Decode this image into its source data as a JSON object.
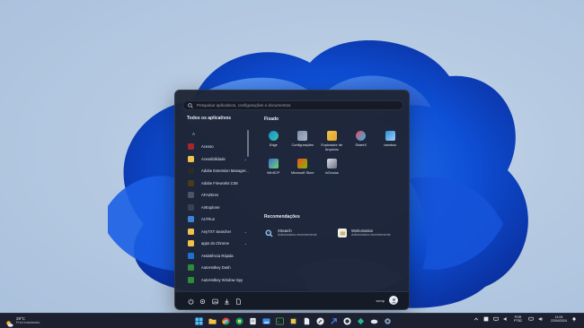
{
  "start_menu": {
    "search_placeholder": "Pesquisar aplicativos, configurações e documentos",
    "all_apps_header": "Todos os aplicativos",
    "section_letter": "A",
    "apps": [
      {
        "label": "Acesso",
        "icon": "access-icon",
        "color": "#a4262c",
        "expandable": false
      },
      {
        "label": "Acessibilidade",
        "icon": "folder-icon",
        "color": "#f2c04b",
        "expandable": true
      },
      {
        "label": "Adobe Extension Manager...",
        "icon": "adobe-extension-icon",
        "color": "#2b2b2b",
        "expandable": false
      },
      {
        "label": "Adobe Fireworks CS6",
        "icon": "fireworks-icon",
        "color": "#4a3a1a",
        "expandable": false
      },
      {
        "label": "AFAZEres",
        "icon": "afazeres-icon",
        "color": "#4b5567",
        "expandable": false
      },
      {
        "label": "AirExplorer",
        "icon": "airexplorer-icon",
        "color": "#3a4252",
        "expandable": false
      },
      {
        "label": "ALTRun",
        "icon": "altrun-icon",
        "color": "#3c82d6",
        "expandable": false
      },
      {
        "label": "AnyTXT Searcher",
        "icon": "folder-icon",
        "color": "#f2c04b",
        "expandable": true
      },
      {
        "label": "apps do Chrome",
        "icon": "folder-icon",
        "color": "#f2c04b",
        "expandable": true
      },
      {
        "label": "Assistência Rápida",
        "icon": "quick-assist-icon",
        "color": "#1f6fd1",
        "expandable": false
      },
      {
        "label": "AutoHotkey Dash",
        "icon": "autohotkey-icon",
        "color": "#2e8b3a",
        "expandable": false
      },
      {
        "label": "AutoHotkey Window Spy",
        "icon": "autohotkey-icon",
        "color": "#2e8b3a",
        "expandable": false
      }
    ],
    "pinned_header": "Fixado",
    "pinned": [
      {
        "label": "Edge",
        "icon": "edge-icon"
      },
      {
        "label": "Configurações",
        "icon": "settings-icon"
      },
      {
        "label": "Explorador de Arquivos",
        "icon": "file-explorer-icon"
      },
      {
        "label": "ShareX",
        "icon": "sharex-icon"
      },
      {
        "label": "bamboo",
        "icon": "bamboo-icon"
      },
      {
        "label": "WinSCP",
        "icon": "winscp-icon"
      },
      {
        "label": "Microsoft Store",
        "icon": "store-icon"
      },
      {
        "label": "InOculus",
        "icon": "inoculus-icon"
      }
    ],
    "recommended_header": "Recomendações",
    "recommended": [
      {
        "title": "XSearch",
        "subtitle": "Adicionados recentemente",
        "icon": "xsearch-icon"
      },
      {
        "title": "Workomation",
        "subtitle": "Adicionados recentemente",
        "icon": "workomation-icon"
      }
    ],
    "user_name": "ssmp",
    "bottom_icons": [
      "power-icon",
      "settings-icon",
      "gallery-icon",
      "downloads-icon",
      "documents-icon"
    ]
  },
  "taskbar": {
    "weather_temp": "28°C",
    "weather_desc": "Pred ensolarado",
    "language_top": "POR",
    "language_bottom": "PTB2",
    "time": "11:09",
    "date": "22/04/2024"
  },
  "colors": {
    "accent": "#0067c0",
    "menu_bg": "#1e2434",
    "taskbar_bg": "#1c2030"
  }
}
